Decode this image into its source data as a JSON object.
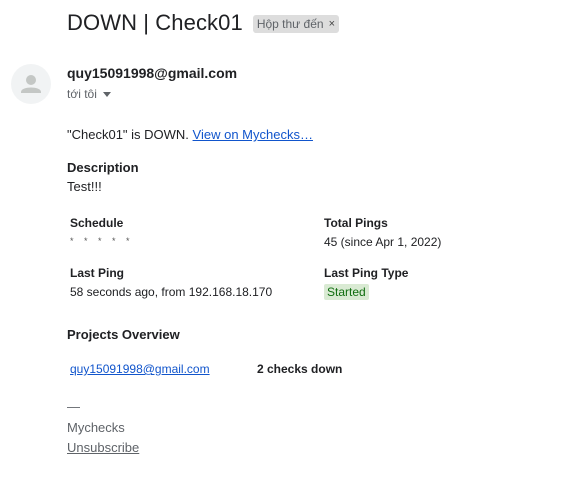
{
  "email": {
    "subject": "DOWN | Check01",
    "label": "Hộp thư đến",
    "label_close": "×",
    "sender": "quy15091998@gmail.com",
    "recipient": "tới tôi"
  },
  "body": {
    "intro": "\"Check01\" is DOWN.",
    "view_link": "View on Mychecks…",
    "description_heading": "Description",
    "description_text": "Test!!!",
    "schedule_heading": "Schedule",
    "schedule_value": "* * * * *",
    "total_pings_heading": "Total Pings",
    "total_pings_value": "45 (since Apr 1, 2022)",
    "last_ping_heading": "Last Ping",
    "last_ping_value": "58 seconds ago, from 192.168.18.170",
    "last_ping_type_heading": "Last Ping Type",
    "last_ping_type_value": "Started",
    "projects_heading": "Projects Overview",
    "project_link": "quy15091998@gmail.com",
    "project_status": "2 checks down"
  },
  "signature": {
    "dash": "—",
    "name": "Mychecks",
    "unsubscribe": "Unsubscribe"
  },
  "colors": {
    "link": "#1155cc",
    "pill_bg": "#d9ead3",
    "pill_text": "#0f6d0f",
    "chip_bg": "#dddddd"
  },
  "icons": {
    "avatar": "person-icon",
    "caret": "caret-down-icon",
    "chip_close": "close-icon"
  }
}
